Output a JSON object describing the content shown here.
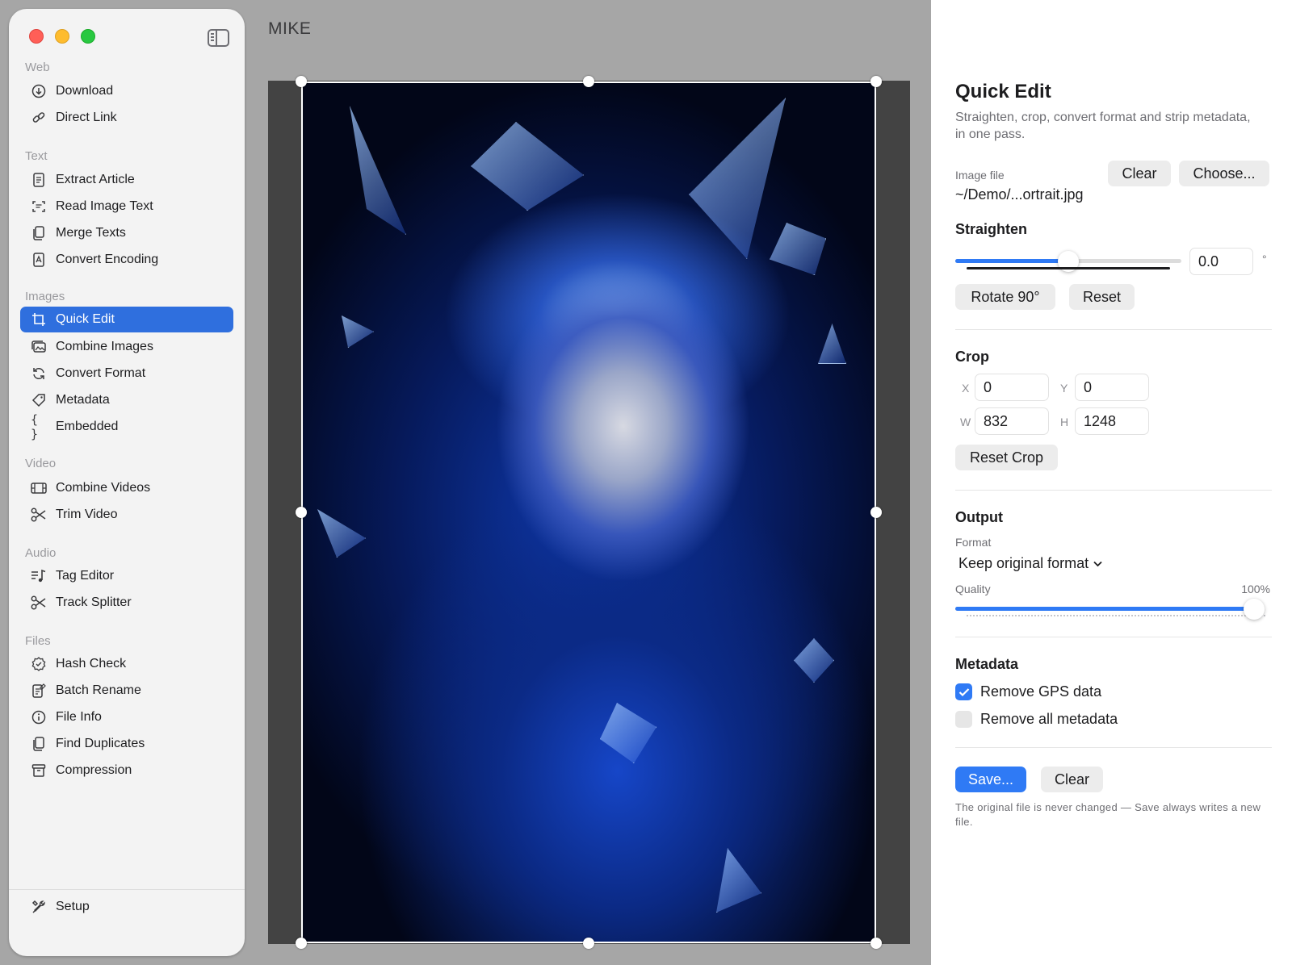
{
  "window": {
    "title": "MIKE"
  },
  "sidebar": {
    "sections": {
      "web": "Web",
      "text": "Text",
      "images": "Images",
      "video": "Video",
      "audio": "Audio",
      "files": "Files"
    },
    "items": {
      "download": "Download",
      "direct_link": "Direct Link",
      "extract_article": "Extract Article",
      "read_image_text": "Read Image Text",
      "merge_texts": "Merge Texts",
      "convert_encoding": "Convert Encoding",
      "quick_edit": "Quick Edit",
      "combine_images": "Combine Images",
      "convert_format": "Convert Format",
      "metadata": "Metadata",
      "embedded": "Embedded",
      "combine_videos": "Combine Videos",
      "trim_video": "Trim Video",
      "tag_editor": "Tag Editor",
      "track_splitter": "Track Splitter",
      "hash_check": "Hash Check",
      "batch_rename": "Batch Rename",
      "file_info": "File Info",
      "find_duplicates": "Find Duplicates",
      "compression": "Compression",
      "setup": "Setup"
    },
    "active_item": "Quick Edit"
  },
  "panel": {
    "title": "Quick Edit",
    "subtitle": "Straighten, crop, convert format and strip metadata, in one pass.",
    "image_file": {
      "label": "Image file",
      "value": "~/Demo/...ortrait.jpg",
      "clear_label": "Clear",
      "choose_label": "Choose..."
    },
    "straighten": {
      "heading": "Straighten",
      "value": "0.0",
      "unit": "°",
      "slider_fraction": 0.5,
      "rotate_label": "Rotate 90°",
      "reset_label": "Reset"
    },
    "crop": {
      "heading": "Crop",
      "x_label": "X",
      "x_value": "0",
      "y_label": "Y",
      "y_value": "0",
      "w_label": "W",
      "w_value": "832",
      "h_label": "H",
      "h_value": "1248",
      "reset_label": "Reset Crop"
    },
    "output": {
      "heading": "Output",
      "format_label": "Format",
      "format_value": "Keep original format",
      "quality_label": "Quality",
      "quality_value": "100%",
      "quality_fraction": 1.0
    },
    "metadata": {
      "heading": "Metadata",
      "remove_gps_label": "Remove GPS data",
      "remove_gps_checked": true,
      "remove_all_label": "Remove all metadata",
      "remove_all_checked": false
    },
    "actions": {
      "save_label": "Save...",
      "clear_label": "Clear",
      "note": "The original file is never changed — Save always writes a new file."
    }
  },
  "colors": {
    "accent": "#2f7af5",
    "sidebar_selection": "#2f6fde"
  }
}
